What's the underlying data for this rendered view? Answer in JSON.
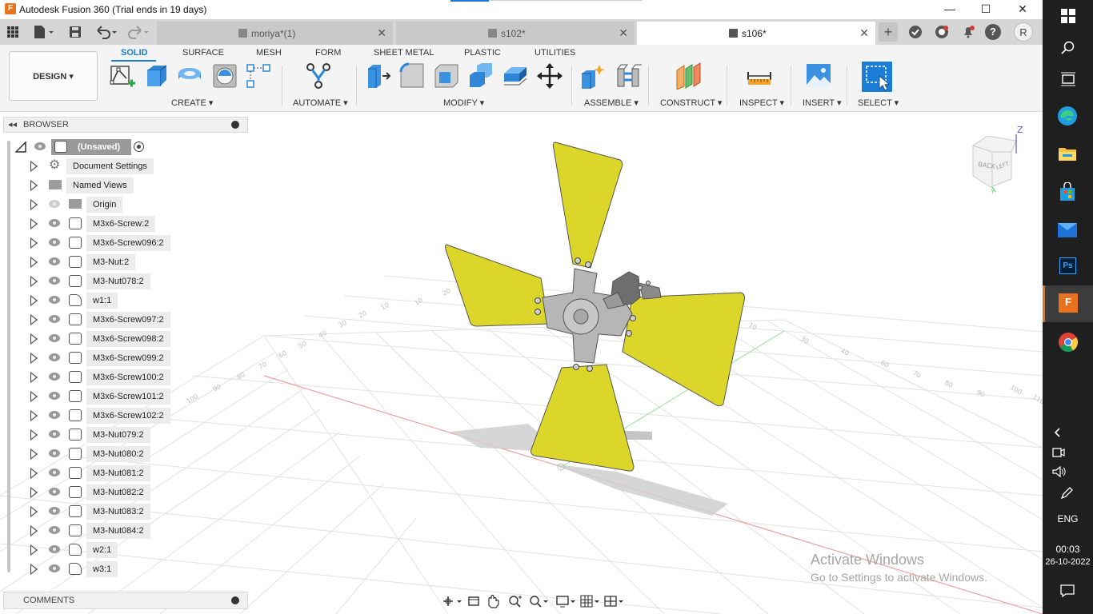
{
  "window": {
    "title": "Autodesk Fusion 360 (Trial ends in 19 days)",
    "minimize": "—",
    "maximize": "☐",
    "close": "✕"
  },
  "tabs": [
    {
      "name": "moriya*(1)",
      "close": "✕"
    },
    {
      "name": "s102*",
      "close": "✕"
    },
    {
      "name": "s106*",
      "close": "✕"
    }
  ],
  "tabbar": {
    "new_tab": "+",
    "user_initial": "R",
    "help": "?"
  },
  "toolbar": {
    "design_label": "DESIGN ▾",
    "workspace_tabs": [
      "SOLID",
      "SURFACE",
      "MESH",
      "FORM",
      "SHEET METAL",
      "PLASTIC",
      "UTILITIES"
    ],
    "groups": {
      "create": "CREATE ▾",
      "automate": "AUTOMATE ▾",
      "modify": "MODIFY ▾",
      "assemble": "ASSEMBLE ▾",
      "construct": "CONSTRUCT ▾",
      "inspect": "INSPECT ▾",
      "insert": "INSERT ▾",
      "select": "SELECT ▾"
    }
  },
  "browser": {
    "title": "BROWSER",
    "collapse": "◂◂",
    "root": "(Unsaved)",
    "items": [
      {
        "label": "Document Settings",
        "kind": "settings"
      },
      {
        "label": "Named Views",
        "kind": "folder"
      },
      {
        "label": "Origin",
        "kind": "origin"
      },
      {
        "label": "M3x6-Screw:2",
        "kind": "component"
      },
      {
        "label": "M3x6-Screw096:2",
        "kind": "component"
      },
      {
        "label": "M3-Nut:2",
        "kind": "component"
      },
      {
        "label": "M3-Nut078:2",
        "kind": "component"
      },
      {
        "label": "w1:1",
        "kind": "linked"
      },
      {
        "label": "M3x6-Screw097:2",
        "kind": "component"
      },
      {
        "label": "M3x6-Screw098:2",
        "kind": "component"
      },
      {
        "label": "M3x6-Screw099:2",
        "kind": "component"
      },
      {
        "label": "M3x6-Screw100:2",
        "kind": "component"
      },
      {
        "label": "M3x6-Screw101:2",
        "kind": "component"
      },
      {
        "label": "M3x6-Screw102:2",
        "kind": "component"
      },
      {
        "label": "M3-Nut079:2",
        "kind": "component"
      },
      {
        "label": "M3-Nut080:2",
        "kind": "component"
      },
      {
        "label": "M3-Nut081:2",
        "kind": "component"
      },
      {
        "label": "M3-Nut082:2",
        "kind": "component"
      },
      {
        "label": "M3-Nut083:2",
        "kind": "component"
      },
      {
        "label": "M3-Nut084:2",
        "kind": "component"
      },
      {
        "label": "w2:1",
        "kind": "linked"
      },
      {
        "label": "w3:1",
        "kind": "linked"
      }
    ]
  },
  "comments": {
    "title": "COMMENTS"
  },
  "viewcube": {
    "back": "BACK",
    "left": "LEFT",
    "z_axis": "Z",
    "y_axis": "Y"
  },
  "watermark": {
    "line1": "Activate Windows",
    "line2": "Go to Settings to activate Windows."
  },
  "taskbar": {
    "time": "00:03",
    "date": "26-10-2022",
    "language": "ENG"
  },
  "colors": {
    "blade": "#dcd62a",
    "hub": "#b6b6b6",
    "accent": "#1c7dd6",
    "fusion_orange": "#e8731f"
  }
}
